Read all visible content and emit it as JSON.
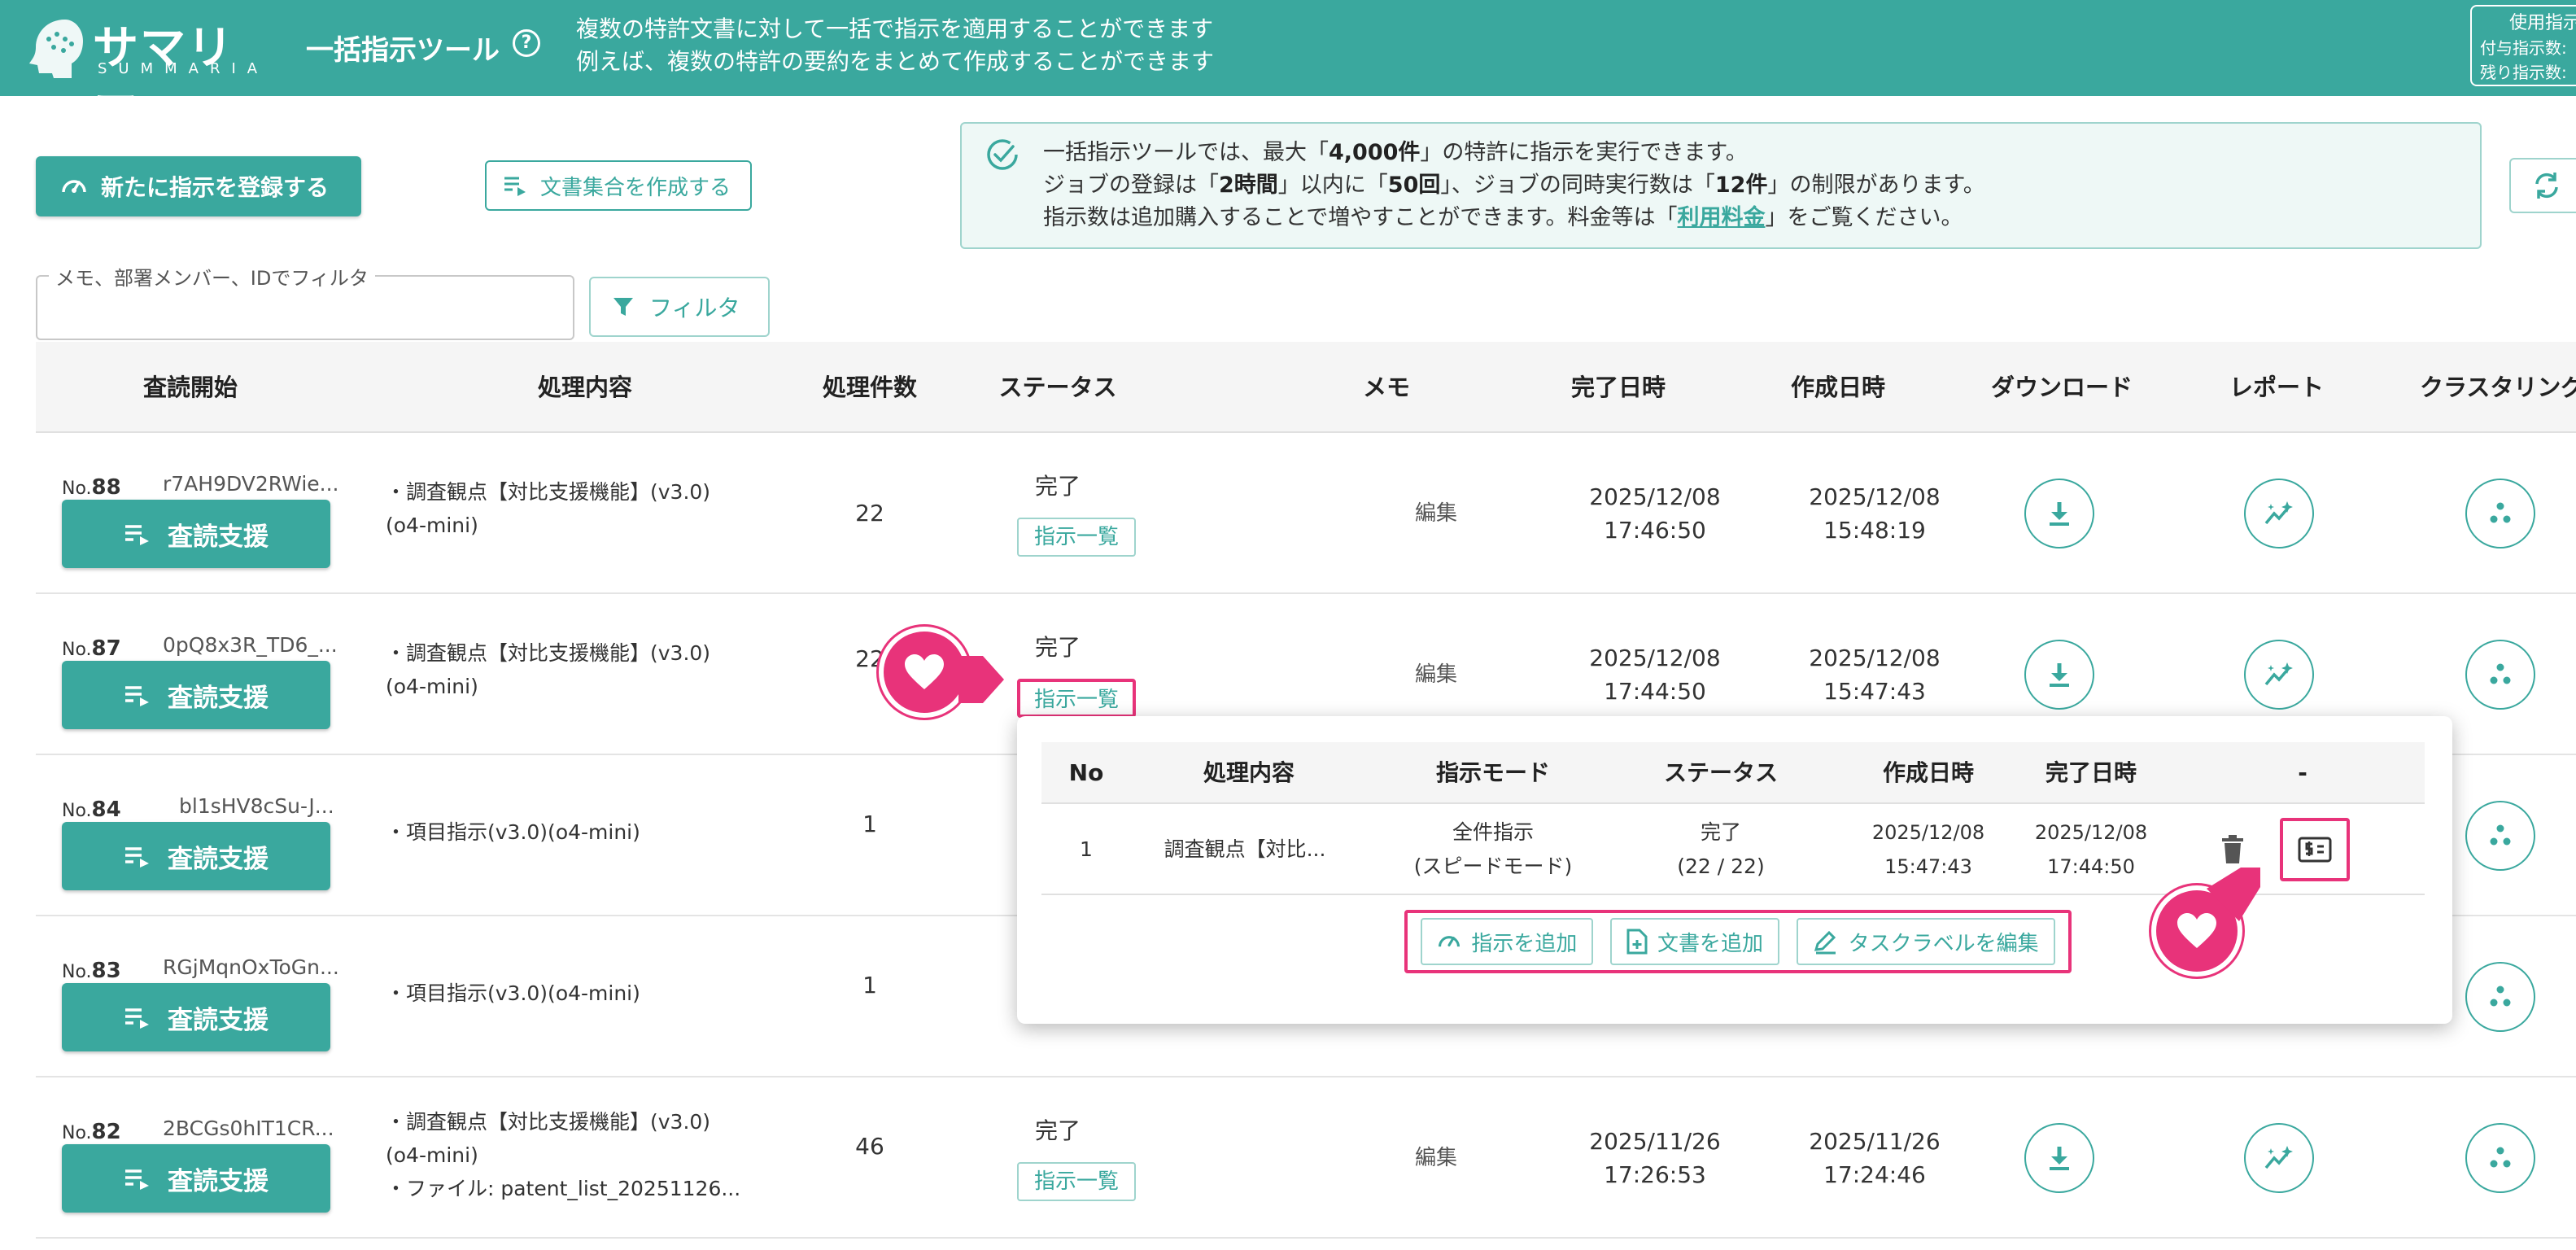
{
  "header": {
    "logo_jp": "サマリア",
    "logo_en": "SUMMARIA",
    "tool_title": "一括指示ツール",
    "desc_line1": "複数の特許文書に対して一括で指示を適用することができます",
    "desc_line2": "例えば、複数の特許の要約をまとめて作成することができます",
    "usage_title": "使用指示",
    "usage_granted": "付与指示数:",
    "usage_remaining": "残り指示数:"
  },
  "toolbar": {
    "register_label": "新たに指示を登録する",
    "create_docset_label": "文書集合を作成する",
    "filter_placeholder_label": "メモ、部署メンバー、IDでフィルタ",
    "filter_button_label": "フィルタ"
  },
  "info": {
    "l1a": "一括指示ツールでは、最大「",
    "l1b": "4,000件",
    "l1c": "」の特許に指示を実行できます。",
    "l2a": "ジョブの登録は「",
    "l2b": "2時間",
    "l2c": "」以内に「",
    "l2d": "50回",
    "l2e": "」、ジョブの同時実行数は「",
    "l2f": "12件",
    "l2g": "」の制限があります。",
    "l3a": "指示数は追加購入することで増やすことができます。料金等は「",
    "l3b": "利用料金",
    "l3c": "」をご覧ください。"
  },
  "table": {
    "headers": [
      "査読開始",
      "処理内容",
      "処理件数",
      "ステータス",
      "メモ",
      "完了日時",
      "作成日時",
      "ダウンロード",
      "レポート",
      "クラスタリング"
    ],
    "review_button_label": "査読支援",
    "list_button_label": "指示一覧",
    "memo_edit_label": "編集",
    "no_prefix": "No.",
    "rows": [
      {
        "no": "88",
        "id": "r7AH9DV2RWie...",
        "content": [
          "・調査観点【対比支援機能】(v3.0)",
          "(o4-mini)"
        ],
        "count": "22",
        "status": "完了",
        "completed": [
          "2025/12/08",
          "17:46:50"
        ],
        "created": [
          "2025/12/08",
          "15:48:19"
        ]
      },
      {
        "no": "87",
        "id": "0pQ8x3R_TD6_...",
        "content": [
          "・調査観点【対比支援機能】(v3.0)",
          "(o4-mini)"
        ],
        "count": "22",
        "status": "完了",
        "completed": [
          "2025/12/08",
          "17:44:50"
        ],
        "created": [
          "2025/12/08",
          "15:47:43"
        ]
      },
      {
        "no": "84",
        "id": "bl1sHV8cSu-J...",
        "content": [
          "・項目指示(v3.0)(o4-mini)"
        ],
        "count": "1",
        "status": "",
        "completed": [
          "",
          ""
        ],
        "created": [
          "",
          ""
        ]
      },
      {
        "no": "83",
        "id": "RGjMqnOxToGn...",
        "content": [
          "・項目指示(v3.0)(o4-mini)"
        ],
        "count": "1",
        "status": "",
        "completed": [
          "",
          ""
        ],
        "created": [
          "",
          ""
        ]
      },
      {
        "no": "82",
        "id": "2BCGs0hIT1CR...",
        "content": [
          "・調査観点【対比支援機能】(v3.0)",
          "(o4-mini)",
          "・ファイル: patent_list_20251126..."
        ],
        "count": "46",
        "status": "完了",
        "completed": [
          "2025/11/26",
          "17:26:53"
        ],
        "created": [
          "2025/11/26",
          "17:24:46"
        ]
      }
    ]
  },
  "popup": {
    "headers": [
      "No",
      "処理内容",
      "指示モード",
      "ステータス",
      "作成日時",
      "完了日時",
      "-"
    ],
    "row": {
      "no": "1",
      "content": "調査観点【対比...",
      "mode1": "全件指示",
      "mode2": "(スピードモード)",
      "status1": "完了",
      "status2": "(22 / 22)",
      "created1": "2025/12/08",
      "created2": "15:47:43",
      "completed1": "2025/12/08",
      "completed2": "17:44:50"
    },
    "add_instruction_label": "指示を追加",
    "add_document_label": "文書を追加",
    "edit_label_label": "タスクラベルを編集"
  },
  "colors": {
    "accent": "#3aa89e",
    "highlight": "#e8337a"
  }
}
